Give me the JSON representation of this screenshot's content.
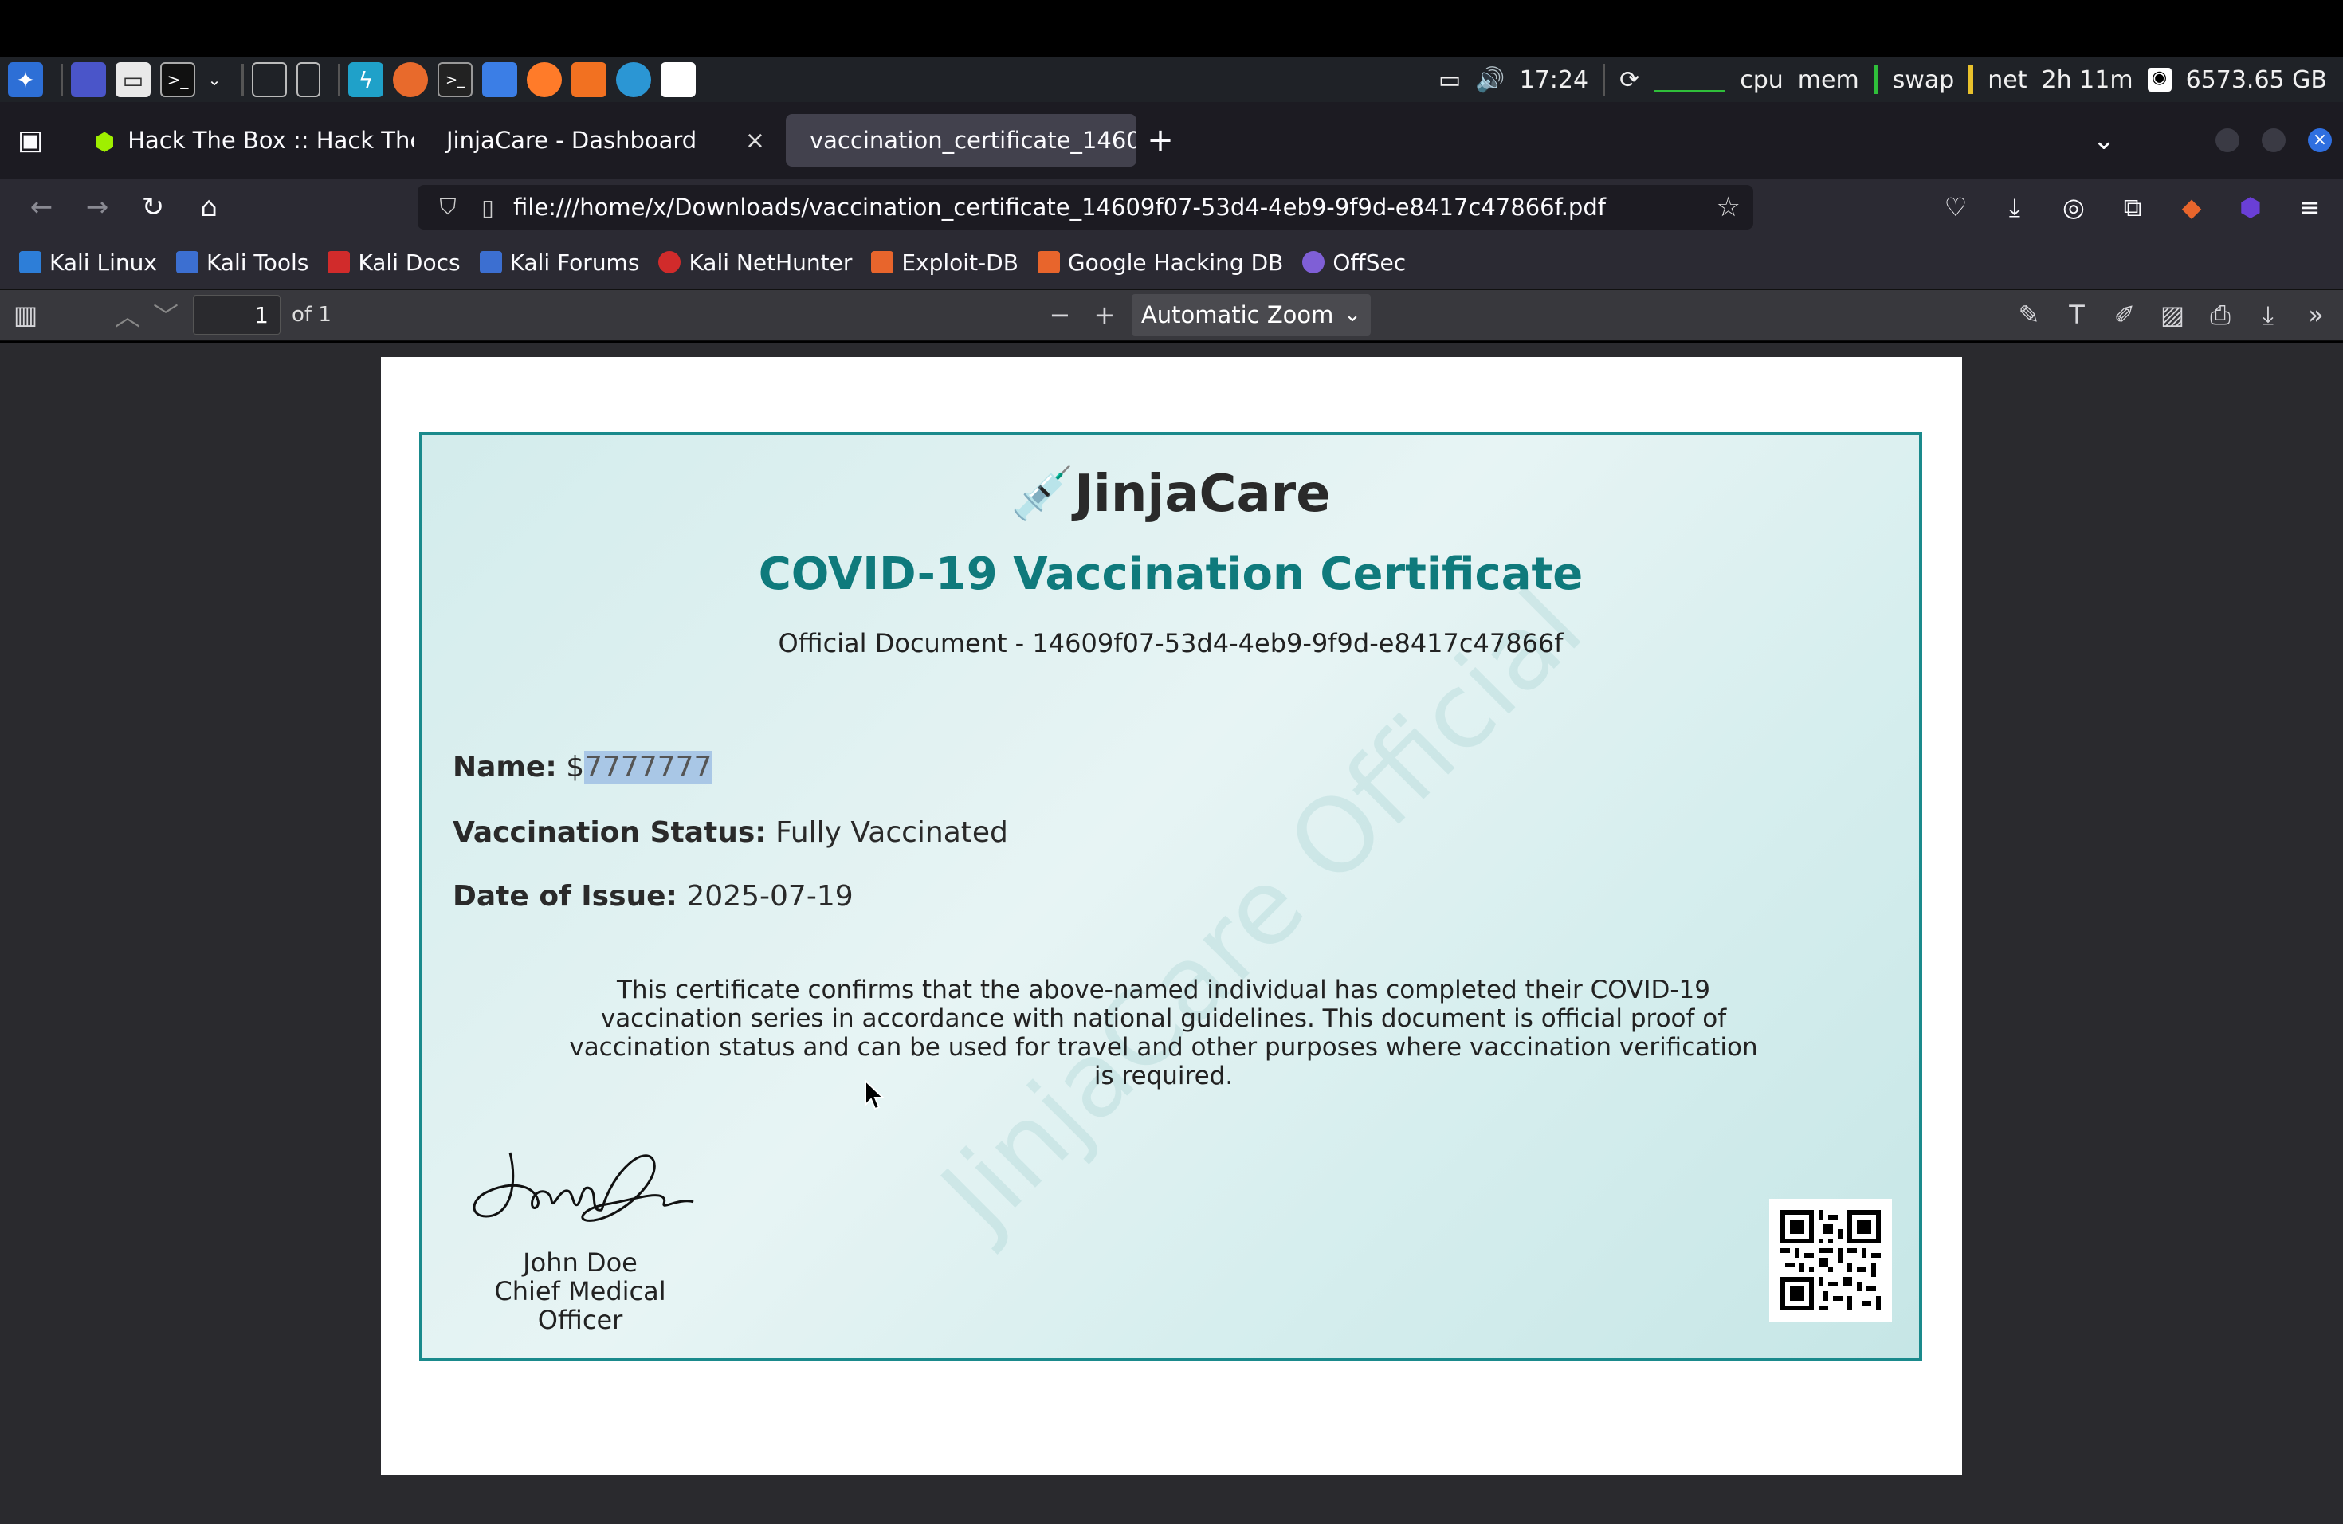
{
  "panel": {
    "clock": "17:24",
    "cpu_label": "cpu",
    "mem_label": "mem",
    "swap_label": "swap",
    "net_label": "net",
    "uptime": "2h 11m",
    "disk": "6573.65 GB"
  },
  "tabs": [
    {
      "label": "Hack The Box :: Hack The",
      "active": false
    },
    {
      "label": "JinjaCare - Dashboard",
      "active": false
    },
    {
      "label": "vaccination_certificate_1460",
      "active": true
    }
  ],
  "new_tab_label": "+",
  "url": "file:///home/x/Downloads/vaccination_certificate_14609f07-53d4-4eb9-9f9d-e8417c47866f.pdf",
  "bookmarks": [
    {
      "label": "Kali Linux",
      "color": "#2d7ed8"
    },
    {
      "label": "Kali Tools",
      "color": "#3c6fd1"
    },
    {
      "label": "Kali Docs",
      "color": "#d12b2b"
    },
    {
      "label": "Kali Forums",
      "color": "#3c6fd1"
    },
    {
      "label": "Kali NetHunter",
      "color": "#d12b2b"
    },
    {
      "label": "Exploit-DB",
      "color": "#e8652c"
    },
    {
      "label": "Google Hacking DB",
      "color": "#e8652c"
    },
    {
      "label": "OffSec",
      "color": "#7f5fd6"
    }
  ],
  "pdf_toolbar": {
    "page_number": "1",
    "page_count": "of 1",
    "zoom": "Automatic Zoom"
  },
  "certificate": {
    "brand": "JinjaCare",
    "title": "COVID-19 Vaccination Certificate",
    "document_line": "Official Document - 14609f07-53d4-4eb9-9f9d-e8417c47866f",
    "name_label": "Name:",
    "name_prefix": "$",
    "name_value": "7777777",
    "status_label": "Vaccination Status:",
    "status_value": "Fully Vaccinated",
    "date_label": "Date of Issue:",
    "date_value": "2025-07-19",
    "paragraph": "This certificate confirms that the above-named individual has completed their COVID-19 vaccination series in accordance with national guidelines. This document is official proof of vaccination status and can be used for travel and other purposes where vaccination verification is required.",
    "signer_name": "John Doe",
    "signer_title": "Chief Medical Officer",
    "watermark": "JinjaCare Official"
  },
  "colors": {
    "accent": "#0f7a7c",
    "border": "#1a8a8c"
  }
}
